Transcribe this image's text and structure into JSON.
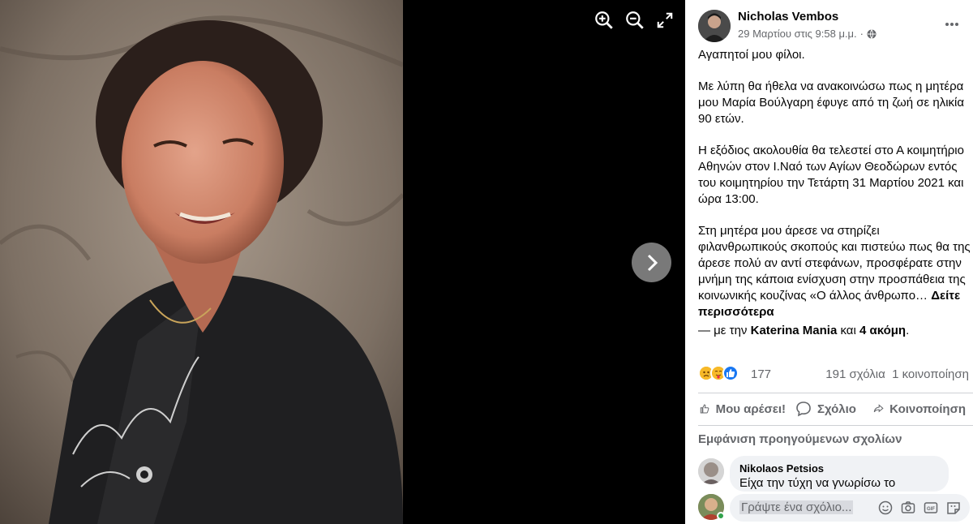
{
  "viewer": {
    "zoom_in_icon": "zoom-in-icon",
    "zoom_out_icon": "zoom-out-icon",
    "fullscreen_icon": "expand-icon",
    "next_icon": "chevron-right-icon"
  },
  "post": {
    "author": "Nicholas Vembos",
    "timestamp": "29 Μαρτίου στις 9:58 μ.μ.",
    "separator": "·",
    "audience_icon": "globe-icon",
    "more_icon": "ellipsis-icon",
    "paragraphs": [
      "Αγαπητοί μου φίλοι.",
      "Με λύπη θα ήθελα να ανακοινώσω πως η μητέρα μου Μαρία Βούλγαρη έφυγε από τη ζωή σε ηλικία 90 ετών.",
      "Η εξόδιος ακολουθία θα τελεστεί στο Α κοιμητήριο Αθηνών στον Ι.Ναό των Αγίων Θεοδώρων εντός του κοιμητηρίου την Τετάρτη 31 Μαρτίου 2021 και ώρα 13:00.",
      "Στη μητέρα μου άρεσε να στηρίζει φιλανθρωπικούς σκοπούς και πιστεύω πως θα της άρεσε πολύ αν αντί στεφάνων, προσφέρατε στην μνήμη της κάποια ενίσχυση στην προσπάθεια της κοινωνικής κουζίνας «Ο άλλος άνθρωπο…"
    ],
    "see_more": "Δείτε περισσότερα",
    "tagged": {
      "prefix": "— με την",
      "person": "Katerina Mania",
      "joiner": "και",
      "others": "4 ακόμη",
      "suffix": "."
    }
  },
  "stats": {
    "reaction_count": "177",
    "comments": "191 σχόλια",
    "shares": "1 κοινοποίηση",
    "reaction_icons": [
      "sad-icon",
      "care-icon",
      "like-icon"
    ]
  },
  "actions": {
    "like": "Μου αρέσει!",
    "comment": "Σχόλιο",
    "share": "Κοινοποίηση"
  },
  "comments": {
    "view_previous": "Εμφάνιση προηγούμενων σχολίων",
    "items": [
      {
        "author": "Nikolaos Petsios",
        "text": "Είχα την τύχη να γνωρίσω το"
      }
    ]
  },
  "composer": {
    "placeholder": "Γράψτε ένα σχόλιο...",
    "icons": [
      "emoji-icon",
      "camera-icon",
      "gif-icon",
      "sticker-icon"
    ]
  },
  "colors": {
    "panel_bg": "#ffffff",
    "secondary_text": "#65676b",
    "bubble_bg": "#f0f2f5",
    "like_blue": "#1877f2",
    "online_green": "#31a24c"
  }
}
